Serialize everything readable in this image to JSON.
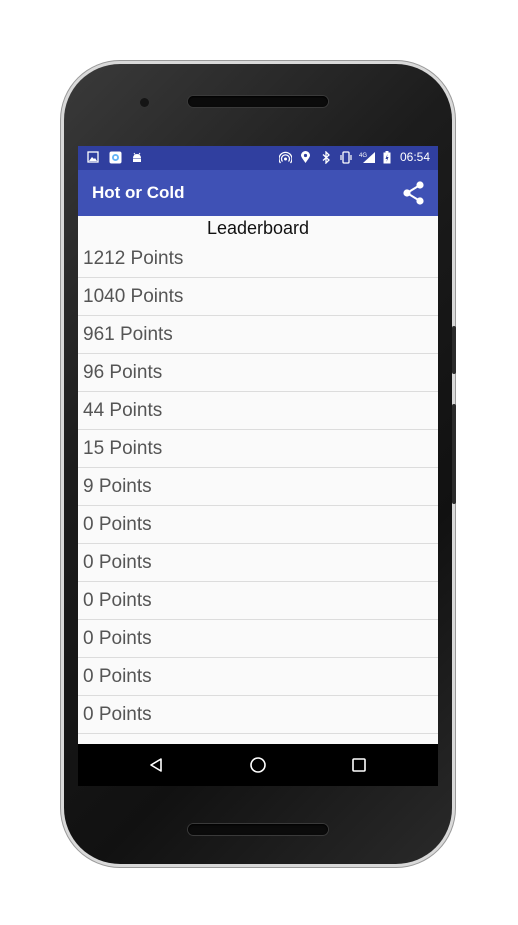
{
  "status_bar": {
    "left_icons": [
      "image-icon",
      "app-icon",
      "android-icon"
    ],
    "right_icons": [
      "hotspot-icon",
      "location-icon",
      "bluetooth-icon",
      "vibrate-icon",
      "signal-icon",
      "battery-icon"
    ],
    "network": "4G",
    "time": "06:54"
  },
  "app_bar": {
    "title": "Hot or Cold",
    "share_icon": "share-icon"
  },
  "leaderboard": {
    "heading": "Leaderboard",
    "rows": [
      "1212 Points",
      "1040 Points",
      "961 Points",
      "96 Points",
      "44 Points",
      "15 Points",
      "9 Points",
      "0 Points",
      "0 Points",
      "0 Points",
      "0 Points",
      "0 Points",
      "0 Points"
    ]
  },
  "nav_bar": {
    "buttons": [
      "back-icon",
      "home-icon",
      "recents-icon"
    ]
  },
  "colors": {
    "status_bar": "#303F9F",
    "app_bar": "#3F51B5",
    "background": "#fafafa",
    "row_text": "#555555"
  }
}
